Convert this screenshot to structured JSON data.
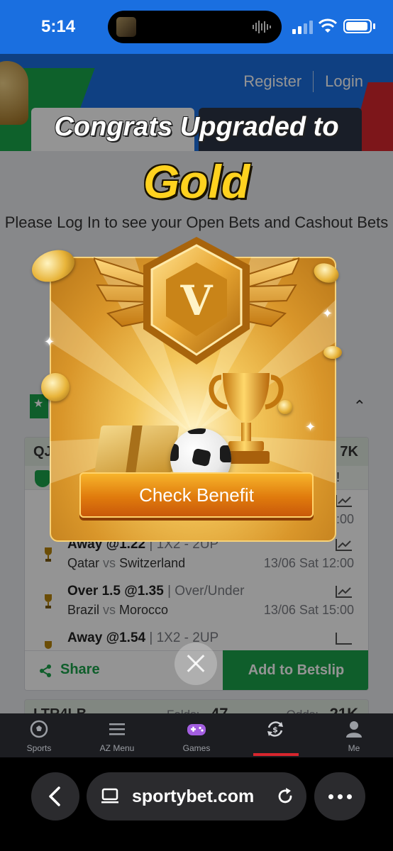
{
  "status_bar": {
    "time": "5:14"
  },
  "header": {
    "register": "Register",
    "login": "Login"
  },
  "open_bets": {
    "message": "Please Log In to see your Open Bets and Cashout Bets"
  },
  "card": {
    "code": "QJ",
    "total_odds": "7K",
    "bets": [
      {
        "pick": "Away @1.22",
        "market": "1X2 - 2UP",
        "home": "Qatar",
        "vs": "vs",
        "away": "Switzerland",
        "date": "13/06 Sat 12:00"
      },
      {
        "pick": "Over 1.5 @1.35",
        "market": "Over/Under",
        "home": "Brazil",
        "vs": "vs",
        "away": "Morocco",
        "date": "13/06 Sat 15:00"
      },
      {
        "pick": "Away @1.54",
        "market": "1X2 - 2UP"
      }
    ],
    "partial_time": ":00",
    "share": "Share",
    "add_to_betslip": "Add to Betslip"
  },
  "card2": {
    "code": "LTR4LB",
    "folds_label": "Folds:",
    "folds": "47",
    "odds_label": "Odds:",
    "odds": "21K"
  },
  "promo": {
    "headline": "Congrats Upgraded to",
    "tier": "Gold",
    "badge_letter": "V",
    "button": "Check Benefit"
  },
  "nav": {
    "items": [
      {
        "label": "Sports",
        "icon": "soccer-ball-icon"
      },
      {
        "label": "AZ Menu",
        "icon": "menu-icon"
      },
      {
        "label": "Games",
        "icon": "gamepad-icon"
      },
      {
        "label": "",
        "icon": "cashout-icon"
      },
      {
        "label": "Me",
        "icon": "user-icon"
      }
    ]
  },
  "browser": {
    "url": "sportybet.com"
  },
  "colors": {
    "brand_blue": "#1b6fe0",
    "brand_green": "#1aa24a",
    "gold": "#ffd21f",
    "nav_active": "#d8262e"
  }
}
